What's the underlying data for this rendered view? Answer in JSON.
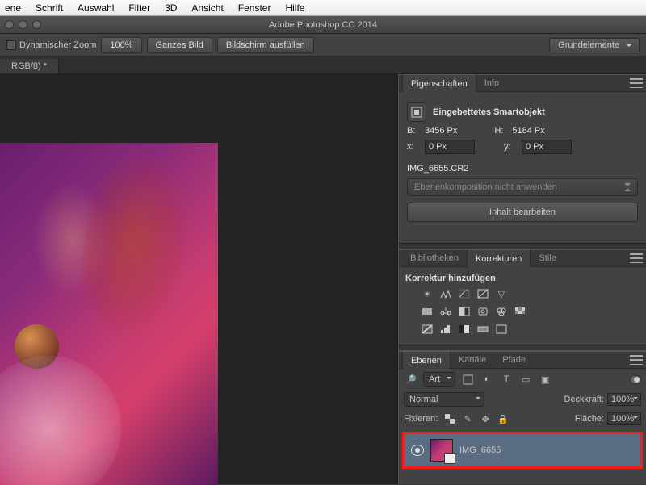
{
  "menu": {
    "items": [
      "ene",
      "Schrift",
      "Auswahl",
      "Filter",
      "3D",
      "Ansicht",
      "Fenster",
      "Hilfe"
    ]
  },
  "app_title": "Adobe Photoshop CC 2014",
  "options_bar": {
    "dyn_zoom": "Dynamischer Zoom",
    "zoom_pct": "100%",
    "fit_screen": "Ganzes Bild",
    "fill_screen": "Bildschirm ausfüllen",
    "workspace": "Grundelemente"
  },
  "doc_tab": "RGB/8) *",
  "properties": {
    "tab_props": "Eigenschaften",
    "tab_info": "Info",
    "type_label": "Eingebettetes Smartobjekt",
    "w_label": "B:",
    "w_val": "3456 Px",
    "h_label": "H:",
    "h_val": "5184 Px",
    "x_label": "x:",
    "x_val": "0 Px",
    "y_label": "y:",
    "y_val": "0 Px",
    "filename": "IMG_6655.CR2",
    "layercomp_dd": "Ebenenkomposition nicht anwenden",
    "edit_btn": "Inhalt bearbeiten"
  },
  "adjustments": {
    "tab_lib": "Bibliotheken",
    "tab_adj": "Korrekturen",
    "tab_styles": "Stile",
    "heading": "Korrektur hinzufügen"
  },
  "layers": {
    "tab_layers": "Ebenen",
    "tab_channels": "Kanäle",
    "tab_paths": "Pfade",
    "filter_kind": "Art",
    "blend_mode": "Normal",
    "opacity_lbl": "Deckkraft:",
    "opacity_val": "100%",
    "lock_lbl": "Fixieren:",
    "fill_lbl": "Fläche:",
    "fill_val": "100%",
    "layer_name": "IMG_6655"
  }
}
